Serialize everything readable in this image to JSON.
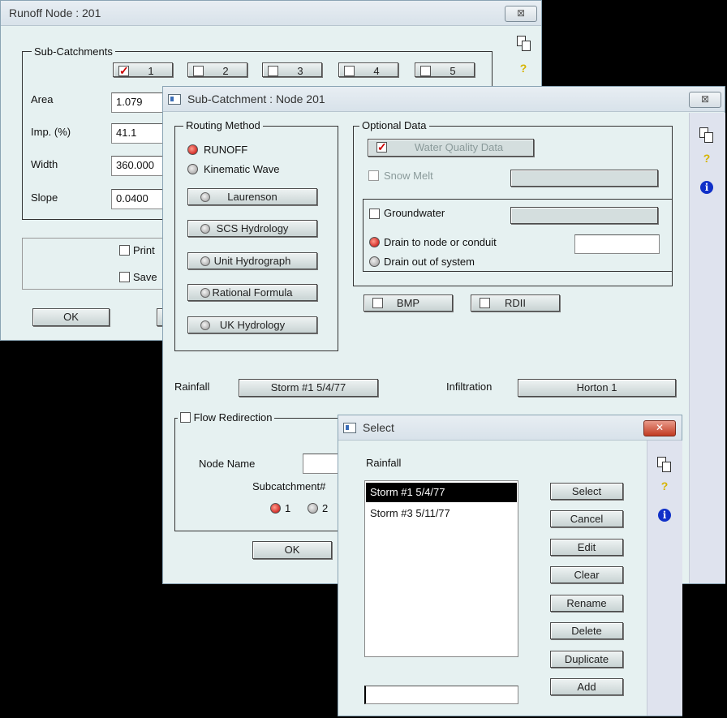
{
  "runoff_window": {
    "title": "Runoff Node : 201",
    "close": "⊠",
    "subcatchments_legend": "Sub-Catchments",
    "subcatch_buttons": [
      "1",
      "2",
      "3",
      "4",
      "5"
    ],
    "area_label": "Area",
    "area_value": "1.079",
    "imp_label": "Imp. (%)",
    "imp_value": "41.1",
    "width_label": "Width",
    "width_value": "360.000",
    "slope_label": "Slope",
    "slope_value": "0.0400",
    "print_label": "Print",
    "save_label": "Save",
    "ok_label": "OK"
  },
  "subcatch_window": {
    "title": "Sub-Catchment : Node 201",
    "close": "⊠",
    "routing_legend": "Routing Method",
    "runoff_radio": "RUNOFF",
    "kinematic_radio": "Kinematic Wave",
    "routing_buttons": [
      "Laurenson",
      "SCS Hydrology",
      "Unit Hydrograph",
      "Rational Formula",
      "UK Hydrology"
    ],
    "optional_legend": "Optional Data",
    "water_quality": "Water Quality Data",
    "snow_melt": "Snow Melt",
    "groundwater": "Groundwater",
    "drain_node": "Drain to node or conduit",
    "drain_out": "Drain out of system",
    "bmp": "BMP",
    "rdii": "RDII",
    "rainfall_label": "Rainfall",
    "rainfall_value": "Storm #1 5/4/77",
    "infiltration_label": "Infiltration",
    "infiltration_value": "Horton 1",
    "flow_redirection": "Flow Redirection",
    "node_name_label": "Node Name",
    "subcatchment_label": "Subcatchment#",
    "sub_radio_1": "1",
    "sub_radio_2": "2",
    "ok_label": "OK"
  },
  "select_window": {
    "title": "Select",
    "close": "✕",
    "list_label": "Rainfall",
    "items": [
      "Storm #1 5/4/77",
      "Storm #3 5/11/77"
    ],
    "buttons": [
      "Select",
      "Cancel",
      "Edit",
      "Clear",
      "Rename",
      "Delete",
      "Duplicate",
      "Add"
    ],
    "input_value": ""
  },
  "side_icons": {
    "help": "?",
    "info": "i"
  },
  "colors": {
    "window_bg": "#e6f1f1",
    "selected_row": "#000000",
    "radio_on": "#c00000",
    "help_icon": "#d6b400",
    "info_icon": "#1030c8"
  }
}
